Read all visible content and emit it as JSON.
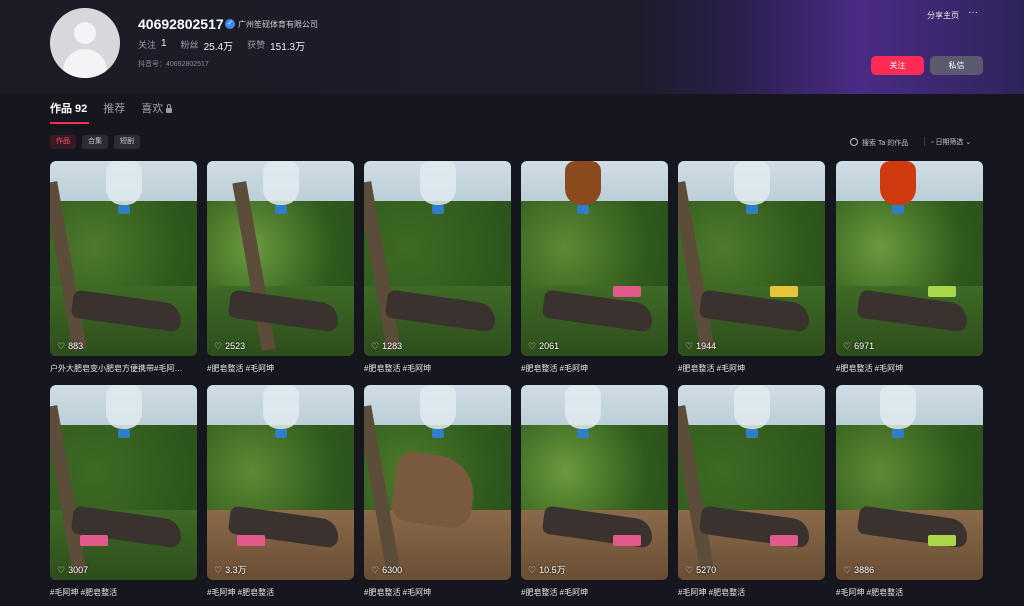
{
  "profile": {
    "username": "40692802517",
    "verified_org": "广州笙砚体育有限公司",
    "following_label": "关注",
    "following": "1",
    "followers_label": "粉丝",
    "followers": "25.4万",
    "likes_label": "获赞",
    "likes": "151.3万",
    "douyin_id": "抖音号：40692802517"
  },
  "header": {
    "share_label": "分享主页",
    "more_label": "···",
    "follow_button": "关注",
    "message_button": "私信"
  },
  "tabs": [
    {
      "label": "作品 92",
      "active": true
    },
    {
      "label": "推荐",
      "active": false
    },
    {
      "label": "喜欢",
      "active": false
    }
  ],
  "filters": {
    "chips": [
      "作品",
      "合集",
      "短剧"
    ],
    "search_label": "搜索 Ta 的作品",
    "date_filter_label": "日期筛选"
  },
  "videos": [
    {
      "likes": "883",
      "caption": "户外大肥皂变小肥皂方便携带#毛阿…",
      "bottle": "clear",
      "soap": ""
    },
    {
      "likes": "2523",
      "caption": "#肥皂整活 #毛阿坤",
      "bottle": "clear",
      "soap": ""
    },
    {
      "likes": "1283",
      "caption": "#肥皂整活 #毛阿坤",
      "bottle": "clear",
      "soap": ""
    },
    {
      "likes": "2061",
      "caption": "#肥皂整活 #毛阿坤",
      "bottle": "brown",
      "soap": "pink"
    },
    {
      "likes": "1944",
      "caption": "#肥皂整活 #毛阿坤",
      "bottle": "clear",
      "soap": "yellow"
    },
    {
      "likes": "6971",
      "caption": "#肥皂整活 #毛阿坤",
      "bottle": "orange",
      "soap": "green"
    },
    {
      "likes": "3007",
      "caption": "#毛阿坤 #肥皂整活",
      "bottle": "clear",
      "soap": "pink"
    },
    {
      "likes": "3.3万",
      "caption": "#毛阿坤 #肥皂整活",
      "bottle": "clear",
      "soap": "pink"
    },
    {
      "likes": "6300",
      "caption": "#肥皂整活 #毛阿坤",
      "bottle": "clear",
      "soap": ""
    },
    {
      "likes": "10.5万",
      "caption": "#肥皂整活 #毛阿坤",
      "bottle": "clear",
      "soap": "pink"
    },
    {
      "likes": "5270",
      "caption": "#毛阿坤 #肥皂整活",
      "bottle": "clear",
      "soap": "pink"
    },
    {
      "likes": "3886",
      "caption": "#毛阿坤 #肥皂整活",
      "bottle": "clear",
      "soap": "green"
    }
  ],
  "colors": {
    "accent": "#fe2c55",
    "background": "#16161e",
    "header_gradient_end": "#4a2b86"
  }
}
